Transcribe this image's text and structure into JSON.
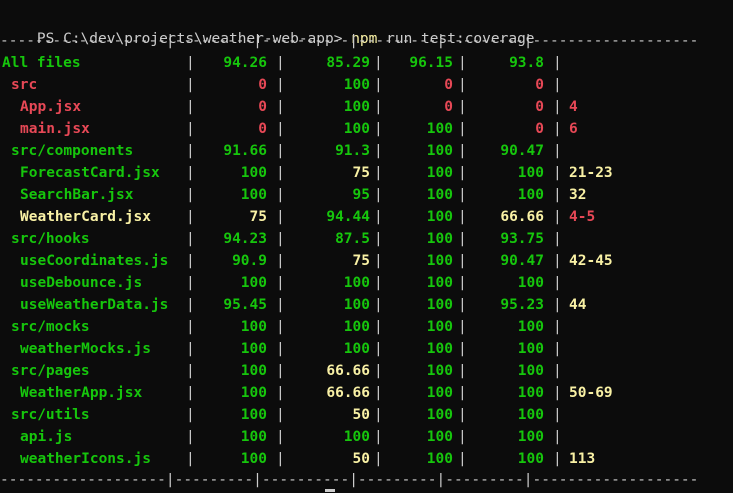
{
  "prompt": {
    "path_text": "PS C:\\dev\\projects\\weather-web-app> ",
    "command": "npm",
    "args": " run test:coverage"
  },
  "separator": "-------------------|---------|----------|---------|---------|-------------------",
  "rows": [
    {
      "name": "All files",
      "stmts": "94.26",
      "branch": "85.29",
      "funcs": "96.15",
      "lines": "93.8",
      "uncovered": "",
      "indent": 0,
      "name_color": "green"
    },
    {
      "name": "src",
      "stmts": "0",
      "branch": "100",
      "funcs": "0",
      "lines": "0",
      "uncovered": "",
      "indent": 1,
      "name_color": "red"
    },
    {
      "name": "App.jsx",
      "stmts": "0",
      "branch": "100",
      "funcs": "0",
      "lines": "0",
      "uncovered": "4",
      "indent": 2,
      "name_color": "red"
    },
    {
      "name": "main.jsx",
      "stmts": "0",
      "branch": "100",
      "funcs": "100",
      "lines": "0",
      "uncovered": "6",
      "indent": 2,
      "name_color": "red"
    },
    {
      "name": "src/components",
      "stmts": "91.66",
      "branch": "91.3",
      "funcs": "100",
      "lines": "90.47",
      "uncovered": "",
      "indent": 1,
      "name_color": "green"
    },
    {
      "name": "ForecastCard.jsx",
      "stmts": "100",
      "branch": "75",
      "funcs": "100",
      "lines": "100",
      "uncovered": "21-23",
      "indent": 2,
      "name_color": "green"
    },
    {
      "name": "SearchBar.jsx",
      "stmts": "100",
      "branch": "95",
      "funcs": "100",
      "lines": "100",
      "uncovered": "32",
      "indent": 2,
      "name_color": "green"
    },
    {
      "name": "WeatherCard.jsx",
      "stmts": "75",
      "branch": "94.44",
      "funcs": "100",
      "lines": "66.66",
      "uncovered": "4-5",
      "indent": 2,
      "name_color": "yellow"
    },
    {
      "name": "src/hooks",
      "stmts": "94.23",
      "branch": "87.5",
      "funcs": "100",
      "lines": "93.75",
      "uncovered": "",
      "indent": 1,
      "name_color": "green"
    },
    {
      "name": "useCoordinates.js",
      "stmts": "90.9",
      "branch": "75",
      "funcs": "100",
      "lines": "90.47",
      "uncovered": "42-45",
      "indent": 2,
      "name_color": "green"
    },
    {
      "name": "useDebounce.js",
      "stmts": "100",
      "branch": "100",
      "funcs": "100",
      "lines": "100",
      "uncovered": "",
      "indent": 2,
      "name_color": "green"
    },
    {
      "name": "useWeatherData.js",
      "stmts": "95.45",
      "branch": "100",
      "funcs": "100",
      "lines": "95.23",
      "uncovered": "44",
      "indent": 2,
      "name_color": "green"
    },
    {
      "name": "src/mocks",
      "stmts": "100",
      "branch": "100",
      "funcs": "100",
      "lines": "100",
      "uncovered": "",
      "indent": 1,
      "name_color": "green"
    },
    {
      "name": "weatherMocks.js",
      "stmts": "100",
      "branch": "100",
      "funcs": "100",
      "lines": "100",
      "uncovered": "",
      "indent": 2,
      "name_color": "green"
    },
    {
      "name": "src/pages",
      "stmts": "100",
      "branch": "66.66",
      "funcs": "100",
      "lines": "100",
      "uncovered": "",
      "indent": 1,
      "name_color": "green"
    },
    {
      "name": "WeatherApp.jsx",
      "stmts": "100",
      "branch": "66.66",
      "funcs": "100",
      "lines": "100",
      "uncovered": "50-69",
      "indent": 2,
      "name_color": "green"
    },
    {
      "name": "src/utils",
      "stmts": "100",
      "branch": "50",
      "funcs": "100",
      "lines": "100",
      "uncovered": "",
      "indent": 1,
      "name_color": "green"
    },
    {
      "name": "api.js",
      "stmts": "100",
      "branch": "100",
      "funcs": "100",
      "lines": "100",
      "uncovered": "",
      "indent": 2,
      "name_color": "green"
    },
    {
      "name": "weatherIcons.js",
      "stmts": "100",
      "branch": "50",
      "funcs": "100",
      "lines": "100",
      "uncovered": "113",
      "indent": 2,
      "name_color": "green"
    }
  ],
  "colors": {
    "background": "#0c0c0c",
    "text": "#cccccc",
    "green": "#16c60c",
    "red": "#e74856",
    "yellow": "#f9f1a5"
  }
}
